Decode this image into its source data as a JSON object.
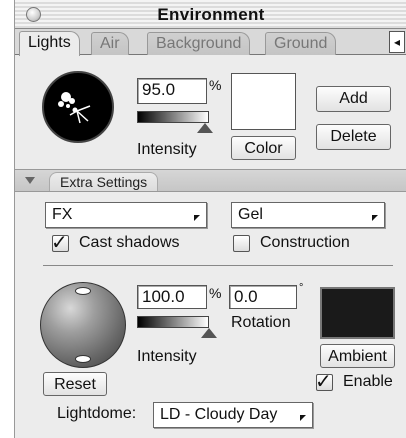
{
  "window": {
    "title": "Environment"
  },
  "tabs": [
    {
      "label": "Lights",
      "active": true
    },
    {
      "label": "Air",
      "active": false
    },
    {
      "label": "Background",
      "active": false
    },
    {
      "label": "Ground",
      "active": false
    }
  ],
  "lights": {
    "intensity_value": "95.0",
    "percent_sign": "%",
    "intensity_label": "Intensity",
    "intensity_level": 0.95,
    "color_button": "Color",
    "color_swatch": "#ffffff",
    "add_button": "Add",
    "delete_button": "Delete"
  },
  "extra_settings": {
    "label": "Extra Settings",
    "fx_popup": "FX",
    "gel_popup": "Gel",
    "cast_shadows_label": "Cast shadows",
    "cast_shadows_checked": true,
    "construction_label": "Construction",
    "construction_checked": false
  },
  "ambient": {
    "intensity_value": "100.0",
    "percent_sign": "%",
    "intensity_label": "Intensity",
    "intensity_level": 1.0,
    "rotation_value": "0.0",
    "degree_sign": "°",
    "rotation_label": "Rotation",
    "ambient_button": "Ambient",
    "ambient_swatch": "#1a1a1a",
    "reset_button": "Reset",
    "enable_label": "Enable",
    "enable_checked": true
  },
  "lightdome": {
    "label": "Lightdome:",
    "value": "LD - Cloudy Day"
  }
}
